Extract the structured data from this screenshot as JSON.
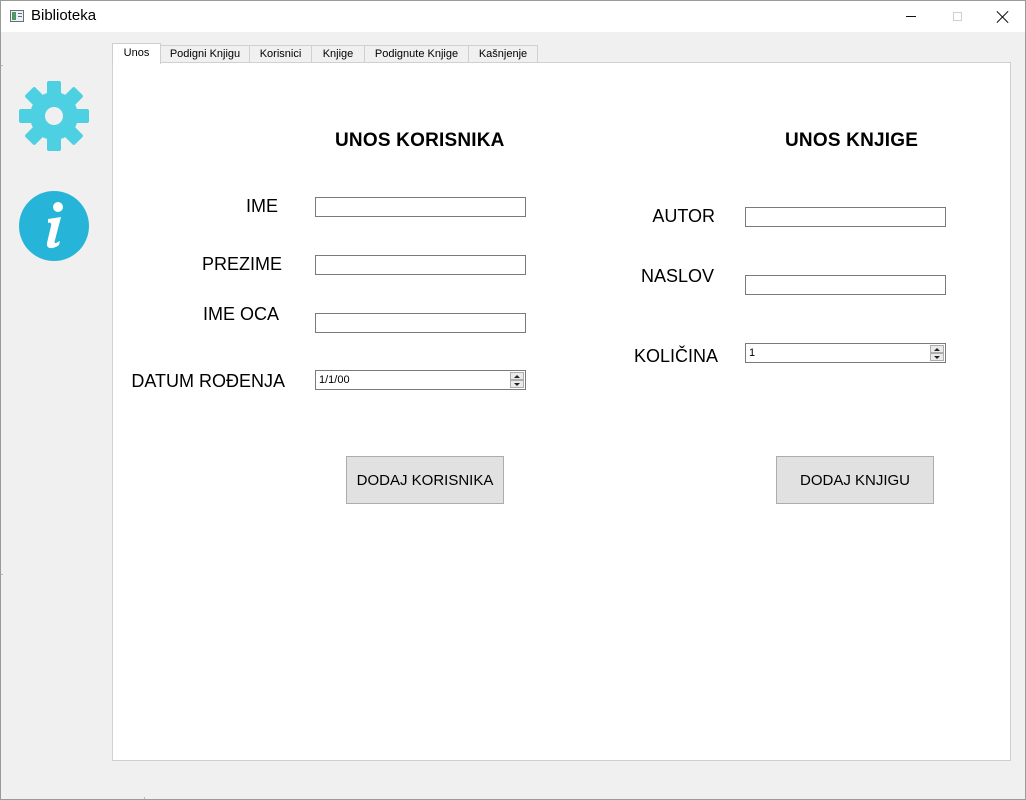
{
  "window": {
    "title": "Biblioteka",
    "minimize_glyph": "—",
    "maximize_glyph": "☐",
    "close_glyph": "✕"
  },
  "sidebar": {
    "icons": [
      {
        "name": "gear-icon",
        "color": "#4dd0e1"
      },
      {
        "name": "info-icon",
        "color": "#26b5d8"
      }
    ]
  },
  "tabs": [
    {
      "label": "Unos",
      "active": true
    },
    {
      "label": "Podigni Knjigu",
      "active": false
    },
    {
      "label": "Korisnici",
      "active": false
    },
    {
      "label": "Knjige",
      "active": false
    },
    {
      "label": "Podignute Knjige",
      "active": false
    },
    {
      "label": "Kašnjenje",
      "active": false
    }
  ],
  "user_form": {
    "heading": "UNOS KORISNIKA",
    "fields": {
      "first_name": {
        "label": "IME",
        "value": ""
      },
      "last_name": {
        "label": "PREZIME",
        "value": ""
      },
      "father_name": {
        "label": "IME OCA",
        "value": ""
      },
      "birth_date": {
        "label": "DATUM ROĐENJA",
        "value": "1/1/00"
      }
    },
    "submit_label": "DODAJ KORISNIKA"
  },
  "book_form": {
    "heading": "UNOS KNJIGE",
    "fields": {
      "author": {
        "label": "AUTOR",
        "value": ""
      },
      "title": {
        "label": "NASLOV",
        "value": ""
      },
      "quantity": {
        "label": "KOLIČINA",
        "value": "1"
      }
    },
    "submit_label": "DODAJ KNJIGU"
  }
}
